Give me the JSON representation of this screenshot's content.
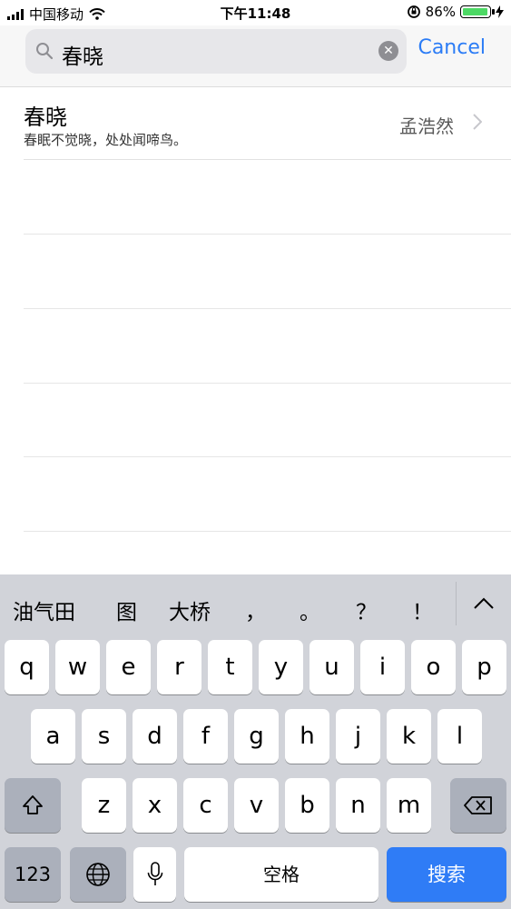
{
  "status_bar": {
    "carrier": "中国移动",
    "time": "下午11:48",
    "battery_percent": "86%",
    "battery_level": 0.86
  },
  "search": {
    "query": "春晓",
    "cancel_label": "Cancel"
  },
  "results": [
    {
      "title": "春晓",
      "subtitle": "春眠不觉晓，处处闻啼鸟。",
      "author": "孟浩然"
    }
  ],
  "keyboard": {
    "candidates": [
      "油气田",
      "图",
      "大桥",
      "，",
      "。",
      "？",
      "！"
    ],
    "row1": [
      "q",
      "w",
      "e",
      "r",
      "t",
      "y",
      "u",
      "i",
      "o",
      "p"
    ],
    "row2": [
      "a",
      "s",
      "d",
      "f",
      "g",
      "h",
      "j",
      "k",
      "l"
    ],
    "row3": [
      "z",
      "x",
      "c",
      "v",
      "b",
      "n",
      "m"
    ],
    "numbers_label": "123",
    "space_label": "空格",
    "search_label": "搜索"
  },
  "colors": {
    "accent": "#2b7cf6",
    "search_key": "#2f7cf6",
    "battery": "#4cd964",
    "keyboard_bg": "#d1d3d9"
  }
}
